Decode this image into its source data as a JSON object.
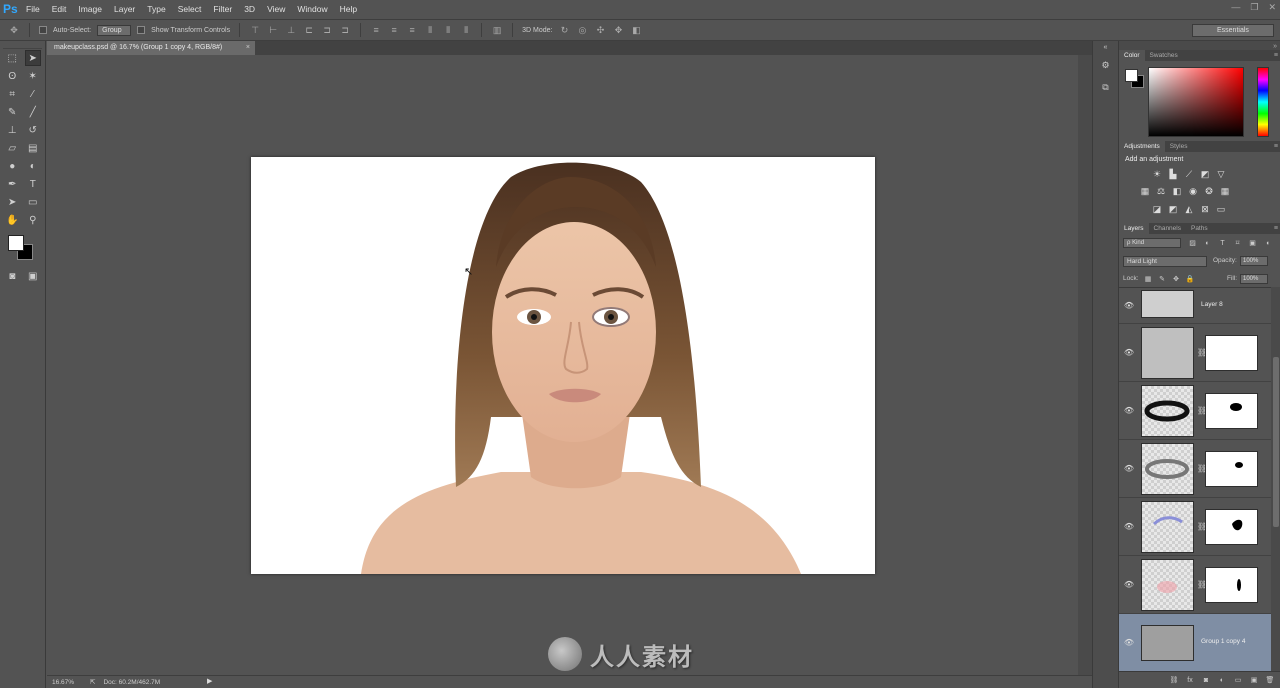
{
  "app": {
    "logo": "Ps"
  },
  "menu": [
    "File",
    "Edit",
    "Image",
    "Layer",
    "Type",
    "Select",
    "Filter",
    "3D",
    "View",
    "Window",
    "Help"
  ],
  "window_controls": [
    "—",
    "❐",
    "✕"
  ],
  "options_bar": {
    "auto_select_label": "Auto-Select:",
    "auto_select_value": "Group",
    "show_transform_label": "Show Transform Controls",
    "mode_3d_label": "3D Mode:",
    "workspace": "Essentials"
  },
  "document": {
    "tab_title": "makeupclass.psd @ 16.7% (Group 1 copy 4, RGB/8#)",
    "tab_close": "×"
  },
  "status_bar": {
    "zoom": "16.67%",
    "doc_info": "Doc: 60.2M/462.7M",
    "arrow": "▶"
  },
  "panels": {
    "color": {
      "tabs": [
        "Color",
        "Swatches"
      ],
      "fg_color": "#ffffff",
      "bg_color": "#000000"
    },
    "adjustments": {
      "tabs": [
        "Adjustments",
        "Styles"
      ],
      "title": "Add an adjustment"
    },
    "layers": {
      "tabs": [
        "Layers",
        "Channels",
        "Paths"
      ],
      "filter_kind": "ρ Kind",
      "blend_mode": "Hard Light",
      "opacity_label": "Opacity:",
      "opacity_value": "100%",
      "lock_label": "Lock:",
      "fill_label": "Fill:",
      "fill_value": "100%",
      "items": [
        {
          "name": "Layer 8",
          "has_mask": false,
          "selected": false
        },
        {
          "name": "",
          "has_mask": true,
          "selected": false
        },
        {
          "name": "",
          "has_mask": true,
          "selected": false
        },
        {
          "name": "",
          "has_mask": true,
          "selected": false
        },
        {
          "name": "",
          "has_mask": true,
          "selected": false
        },
        {
          "name": "",
          "has_mask": true,
          "selected": false
        },
        {
          "name": "Group 1 copy 4",
          "has_mask": false,
          "selected": true
        }
      ]
    }
  },
  "watermark": {
    "text": "人人素材"
  },
  "colors": {
    "ui_bg": "#535353",
    "selected_layer": "#7f8ea4",
    "ps_blue": "#31a8ff"
  }
}
